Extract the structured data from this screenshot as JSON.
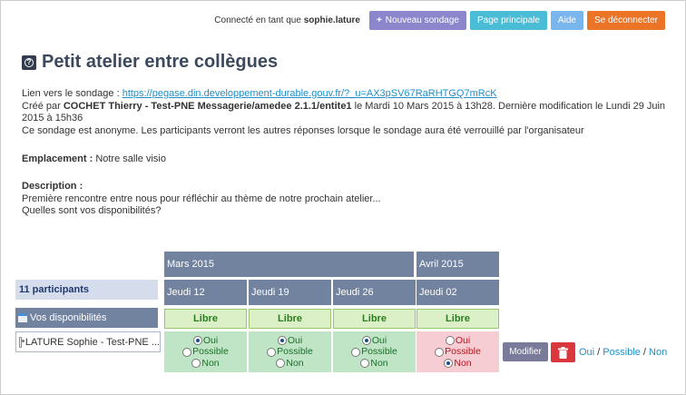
{
  "topbar": {
    "connected_prefix": "Connecté en tant que",
    "username": "sophie.lature",
    "new_poll_label": "Nouveau sondage",
    "main_page_label": "Page principale",
    "help_label": "Aide",
    "logout_label": "Se déconnecter"
  },
  "poll": {
    "title": "Petit atelier entre collègues",
    "link_label": "Lien vers le sondage :",
    "link_url": "https://pegase.din.developpement-durable.gouv.fr/?_u=AX3pSV67RaRHTGQ7mRcK",
    "created_prefix": "Créé par",
    "creator": "COCHET Thierry - Test-PNE Messagerie/amedee 2.1.1/entite1",
    "created_suffix": "le Mardi 10 Mars 2015 à 13h28. Dernière modification le Lundi 29 Juin 2015 à 15h36",
    "anonymous_note": "Ce sondage est anonyme. Les participants verront les autres réponses lorsque le sondage aura été verrouillé par l'organisateur",
    "location_label": "Emplacement :",
    "location": "Notre salle visio",
    "description_label": "Description :",
    "description_line1": "Première rencontre entre nous pour réfléchir au thème de notre prochain atelier...",
    "description_line2": "Quelles sont vos disponibilités?"
  },
  "grid": {
    "participants_label": "11 participants",
    "your_availability_label": "Vos disponibilités",
    "user_name": "LATURE Sophie - Test-PNE ...",
    "months": [
      "Mars 2015",
      "Avril 2015"
    ],
    "days": [
      "Jeudi 12",
      "Jeudi 19",
      "Jeudi 26",
      "Jeudi 02"
    ],
    "free_label": "Libre",
    "options": [
      "Oui",
      "Possible",
      "Non"
    ],
    "selected": [
      "Oui",
      "Oui",
      "Oui",
      "Non"
    ],
    "modify_label": "Modifier",
    "quick_yes": "Oui",
    "quick_possible": "Possible",
    "quick_no": "Non",
    "colors": {
      "header": "#7283a0",
      "vote_yes_bg": "#bfe5c6",
      "vote_no_bg": "#f5cdd2",
      "free_bg": "#dbf0c6"
    }
  }
}
